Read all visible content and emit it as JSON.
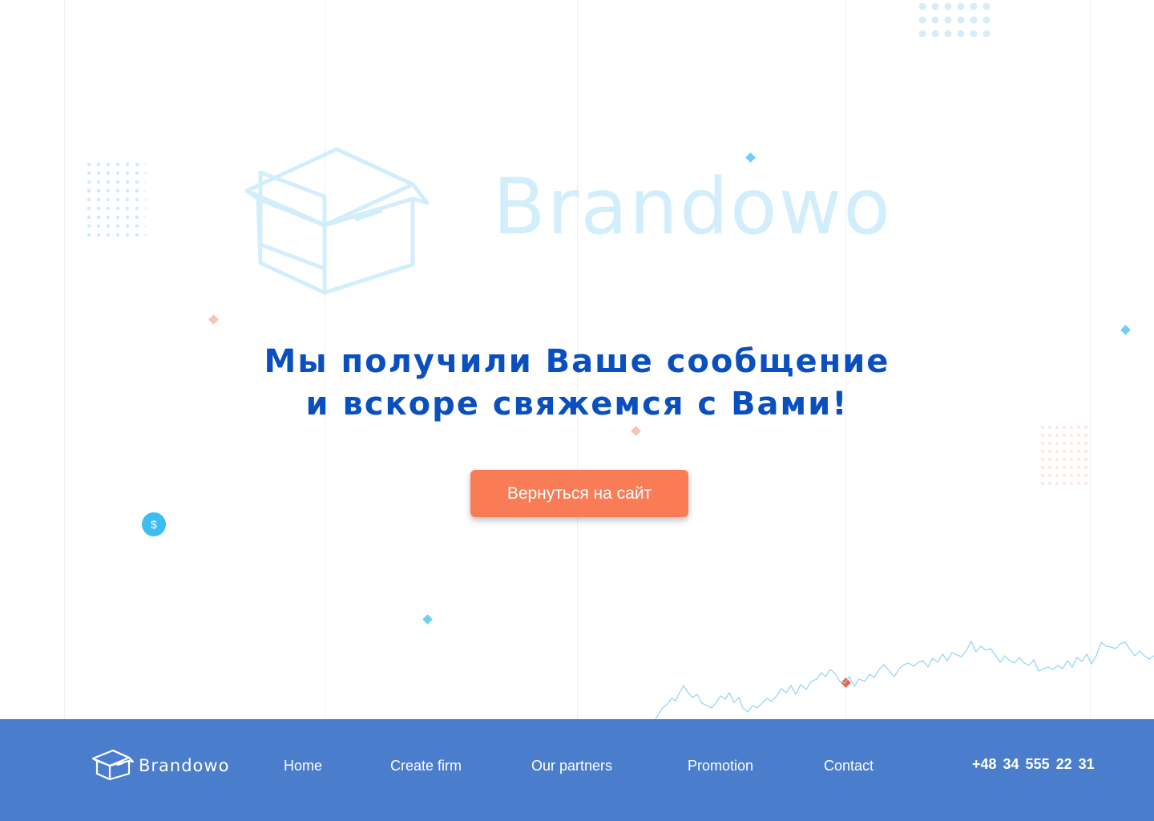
{
  "hero": {
    "brand": "Brandowo",
    "headline_line1": "Мы получили Ваше сообщение",
    "headline_line2": "и вскоре свяжемся с Вами!",
    "button_label": "Вернуться на сайт",
    "coin_symbol": "$"
  },
  "footer": {
    "brand": "Brandowo",
    "nav": [
      "Home",
      "Create firm",
      "Our partners",
      "Promotion",
      "Contact"
    ],
    "phone": "+48  34 555  22 31"
  },
  "colors": {
    "headline": "#0a4fc0",
    "cta": "#f97c57",
    "footer_bg": "#4a7dcb",
    "logo_light": "#d3eefb",
    "accent_blue": "#3bbdf1",
    "accent_orange": "#f0613c"
  },
  "icons": [
    "box-icon",
    "dollar-coin-icon"
  ]
}
